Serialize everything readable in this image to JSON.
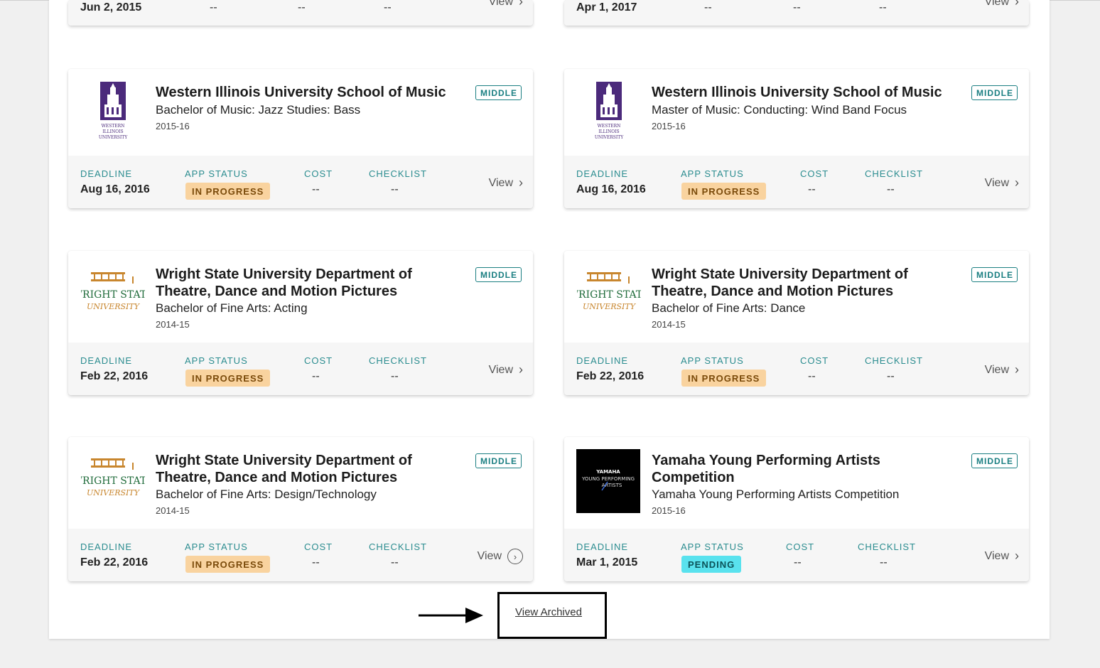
{
  "partial_cards": [
    {
      "deadline": "Jun 2, 2015",
      "cost": "--",
      "checklist": "--",
      "extra": "--",
      "view": "View"
    },
    {
      "deadline": "Apr 1, 2017",
      "cost": "--",
      "checklist": "--",
      "extra": "--",
      "view": "View"
    }
  ],
  "labels": {
    "deadline": "DEADLINE",
    "app_status": "APP STATUS",
    "cost": "COST",
    "checklist": "CHECKLIST",
    "view": "View"
  },
  "cards": [
    {
      "title": "Western Illinois University School of Music",
      "subtitle": "Bachelor of Music: Jazz Studies: Bass",
      "year": "2015-16",
      "badge": "MIDDLE",
      "deadline": "Aug 16, 2016",
      "status": "IN PROGRESS",
      "cost": "--",
      "checklist": "--",
      "logo": "western-illinois-logo"
    },
    {
      "title": "Western Illinois University School of Music",
      "subtitle": "Master of Music: Conducting: Wind Band Focus",
      "year": "2015-16",
      "badge": "MIDDLE",
      "deadline": "Aug 16, 2016",
      "status": "IN PROGRESS",
      "cost": "--",
      "checklist": "--",
      "logo": "western-illinois-logo"
    },
    {
      "title": "Wright State University Department of Theatre, Dance and Motion Pictures",
      "subtitle": "Bachelor of Fine Arts: Acting",
      "year": "2014-15",
      "badge": "MIDDLE",
      "deadline": "Feb 22, 2016",
      "status": "IN PROGRESS",
      "cost": "--",
      "checklist": "--",
      "logo": "wright-state-logo"
    },
    {
      "title": "Wright State University Department of Theatre, Dance and Motion Pictures",
      "subtitle": "Bachelor of Fine Arts: Dance",
      "year": "2014-15",
      "badge": "MIDDLE",
      "deadline": "Feb 22, 2016",
      "status": "IN PROGRESS",
      "cost": "--",
      "checklist": "--",
      "logo": "wright-state-logo"
    },
    {
      "title": "Wright State University Department of Theatre, Dance and Motion Pictures",
      "subtitle": "Bachelor of Fine Arts: Design/Technology",
      "year": "2014-15",
      "badge": "MIDDLE",
      "deadline": "Feb 22, 2016",
      "status": "IN PROGRESS",
      "cost": "--",
      "checklist": "--",
      "logo": "wright-state-logo"
    },
    {
      "title": "Yamaha Young Performing Artists Competition",
      "subtitle": "Yamaha Young Performing Artists Competition",
      "year": "2015-16",
      "badge": "MIDDLE",
      "deadline": "Mar 1, 2015",
      "status": "PENDING",
      "cost": "--",
      "checklist": "--",
      "logo": "yamaha-logo"
    }
  ],
  "logo_text": {
    "wiu": [
      "WESTERN",
      "ILLINOIS",
      "UNIVERSITY"
    ],
    "wsu": [
      "WRIGHT STATE",
      "UNIVERSITY"
    ],
    "yamaha": [
      "YAMAHA",
      "YOUNG PERFORMING",
      "ARTISTS"
    ]
  },
  "footer": {
    "view_archived": "View Archived"
  },
  "colors": {
    "accent": "#2a8c8f",
    "in_progress": "#f9d39f",
    "pending": "#59e2ee"
  }
}
